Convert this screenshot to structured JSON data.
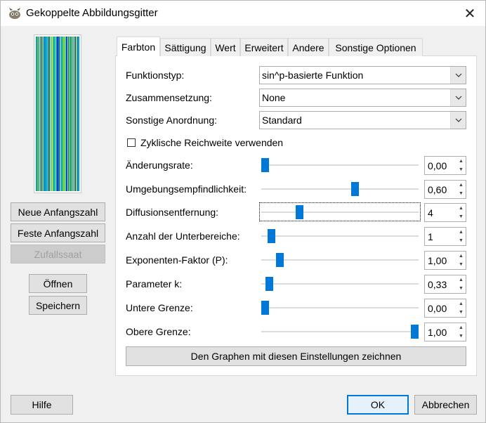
{
  "window": {
    "title": "Gekoppelte Abbildungsgitter",
    "close_icon": "close-icon"
  },
  "left": {
    "new_seed": "Neue Anfangszahl",
    "fixed_seed": "Feste Anfangszahl",
    "random_seed": "Zufallssaat",
    "open": "Öffnen",
    "save": "Speichern"
  },
  "tabs": [
    "Farbton",
    "Sättigung",
    "Wert",
    "Erweitert",
    "Andere",
    "Sonstige Optionen"
  ],
  "fields": {
    "function_type": {
      "label": "Funktionstyp:",
      "value": "sin^p-basierte Funktion"
    },
    "composition": {
      "label": "Zusammensetzung:",
      "value": "None"
    },
    "misc_arrange": {
      "label": "Sonstige Anordnung:",
      "value": "Standard"
    },
    "cyclic": {
      "label": "Zyklische Reichweite verwenden",
      "checked": false
    }
  },
  "sliders": [
    {
      "label": "Änderungsrate:",
      "value": "0,00",
      "fraction": 0.0
    },
    {
      "label": "Umgebungsempfindlichkeit:",
      "value": "0,60",
      "fraction": 0.6
    },
    {
      "label": "Diffusionsentfernung:",
      "value": "4",
      "fraction": 0.23
    },
    {
      "label": "Anzahl der Unterbereiche:",
      "value": "1",
      "fraction": 0.04
    },
    {
      "label": "Exponenten-Faktor (P):",
      "value": "1,00",
      "fraction": 0.1
    },
    {
      "label": "Parameter k:",
      "value": "0,33",
      "fraction": 0.03
    },
    {
      "label": "Untere Grenze:",
      "value": "0,00",
      "fraction": 0.0
    },
    {
      "label": "Obere Grenze:",
      "value": "1,00",
      "fraction": 1.0
    }
  ],
  "draw_graph": "Den Graphen mit diesen Einstellungen zeichnen",
  "footer": {
    "help": "Hilfe",
    "ok": "OK",
    "cancel": "Abbrechen"
  }
}
